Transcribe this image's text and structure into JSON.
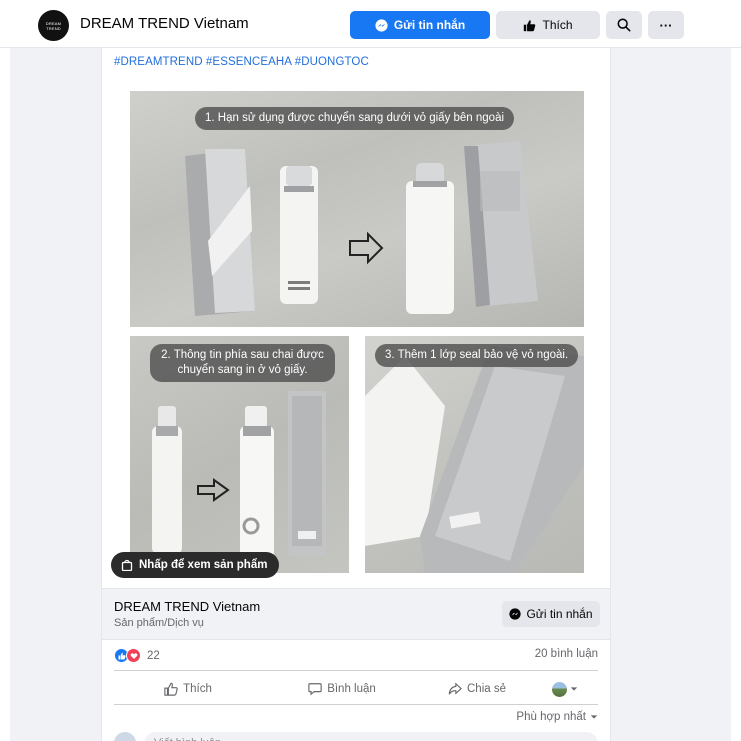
{
  "header": {
    "logo_text": "DREAM TREND",
    "page_name": "DREAM TREND Vietnam",
    "message_button": "Gửi tin nhắn",
    "like_button": "Thích",
    "more_label": "···"
  },
  "post": {
    "hashtags": "#DREAMTREND #ESSENCEAHA #DUONGTOC",
    "captions": {
      "photo1": "1. Hạn sử dụng được chuyển sang dưới vỏ giấy bên ngoài",
      "photo2": "2. Thông tin phía sau chai được chuyển sang in ở vỏ giấy.",
      "photo3": "3. Thêm 1 lớp seal bảo vệ vỏ ngoài."
    },
    "shop_pill": "Nhấp để xem sản phẩm",
    "product": {
      "name": "DREAM TREND Vietnam",
      "category": "Sản phẩm/Dịch vụ",
      "message_button": "Gửi tin nhắn"
    },
    "reaction_count": "22",
    "comment_count": "20 bình luận",
    "actions": {
      "like": "Thích",
      "comment": "Bình luận",
      "share": "Chia sẻ"
    },
    "sort_label": "Phù hợp nhất",
    "comment_placeholder": "Viết bình luận..."
  },
  "colors": {
    "primary": "#1877f2",
    "background": "#f0f2f5",
    "secondary_button": "#e4e6eb",
    "hashtag": "#216fdb",
    "muted_text": "#65676b",
    "love": "#f33e58"
  },
  "icons": [
    "messenger-icon",
    "thumbs-up-icon",
    "search-icon",
    "more-icon",
    "arrow-right-icon",
    "shop-bag-icon",
    "comment-icon",
    "share-icon",
    "chevron-down-icon"
  ]
}
